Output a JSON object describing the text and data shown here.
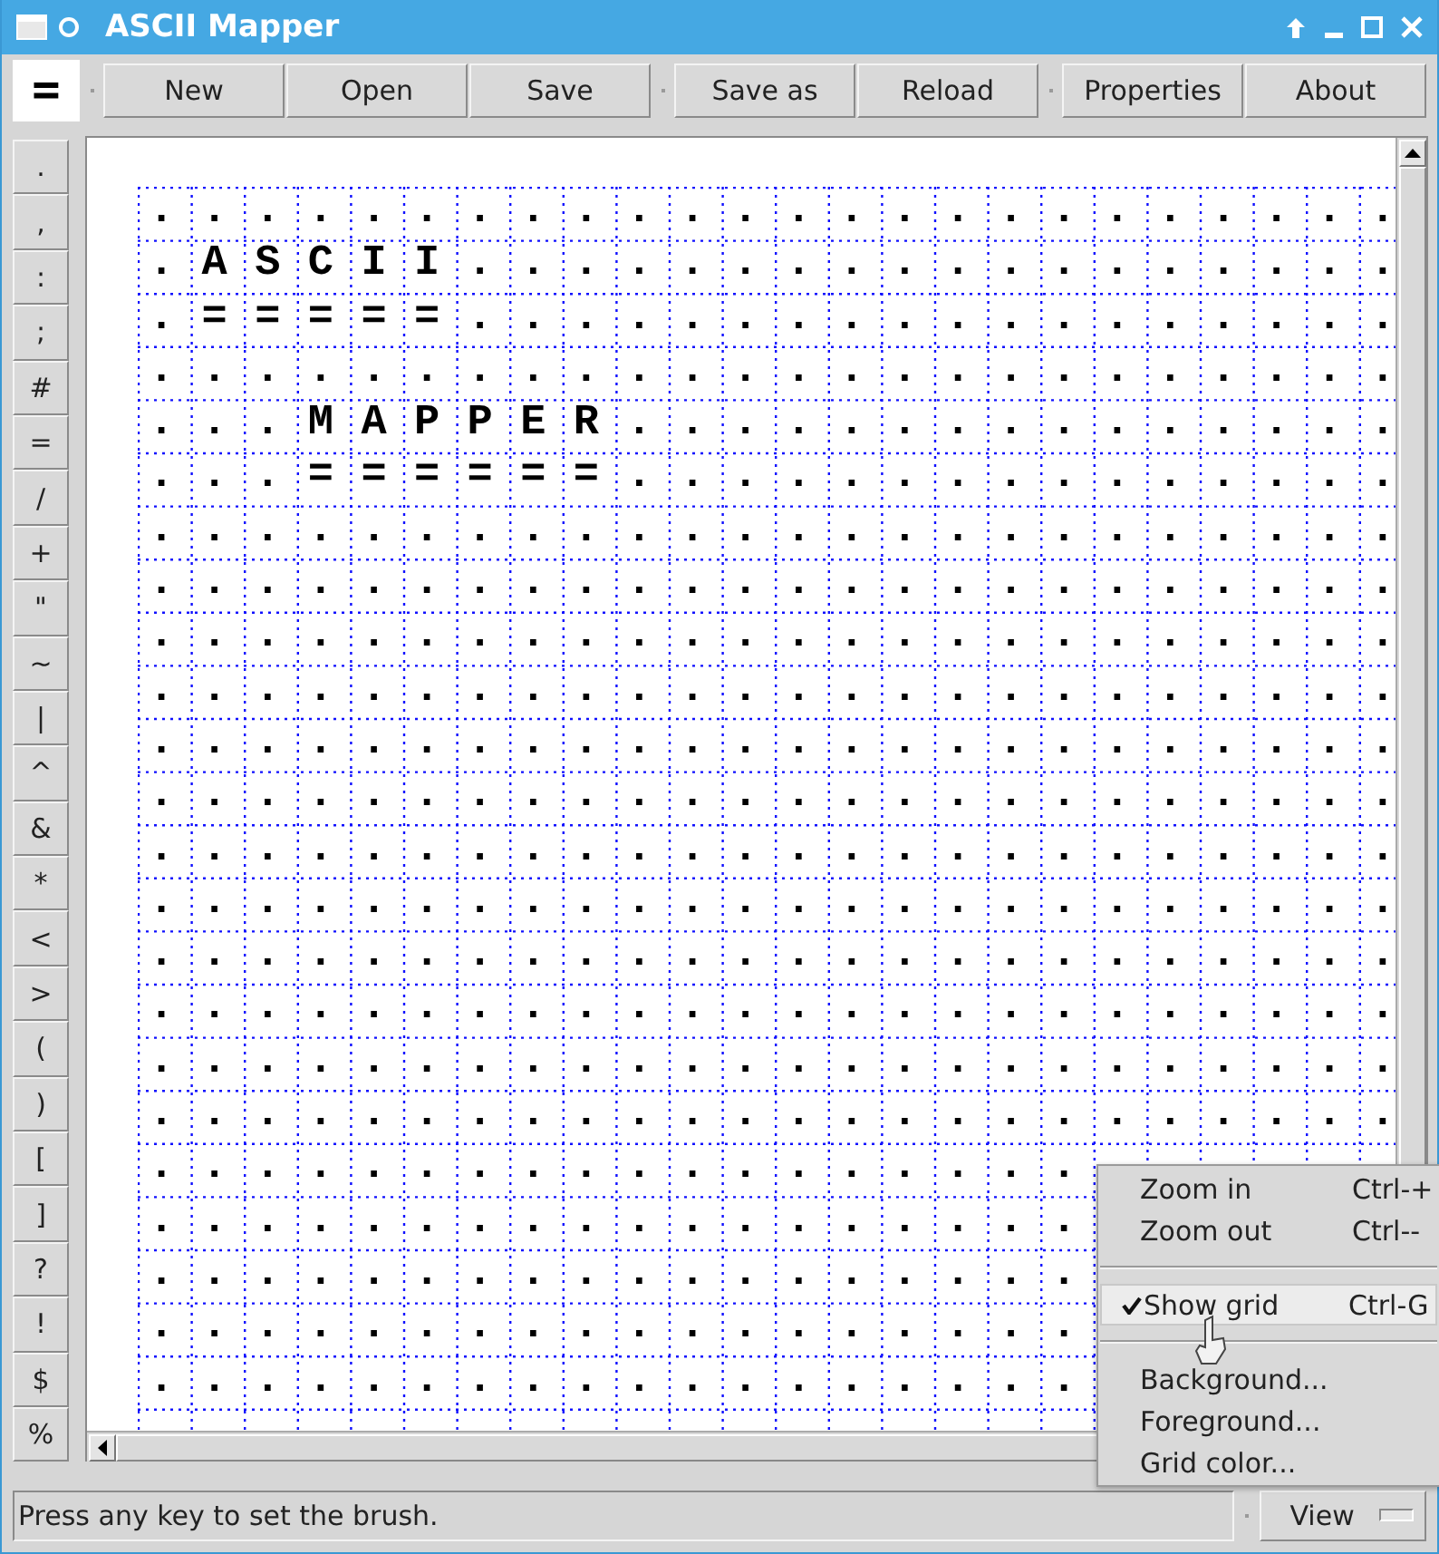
{
  "window": {
    "title": "ASCII Mapper"
  },
  "toolbar": {
    "brush": "=",
    "groups": [
      {
        "buttons": [
          {
            "label": "New"
          },
          {
            "label": "Open"
          },
          {
            "label": "Save"
          }
        ]
      },
      {
        "buttons": [
          {
            "label": "Save as"
          },
          {
            "label": "Reload"
          }
        ]
      },
      {
        "buttons": [
          {
            "label": "Properties"
          },
          {
            "label": "About"
          }
        ]
      }
    ]
  },
  "palette": [
    ".",
    ",",
    ":",
    ";",
    "#",
    "=",
    "/",
    "+",
    "\"",
    "~",
    "|",
    "^",
    "&",
    "*",
    "<",
    ">",
    "(",
    ")",
    "[",
    "]",
    "?",
    "!",
    "$",
    "%"
  ],
  "map": {
    "show_grid": true,
    "rows": [
      [
        ".",
        ".",
        ".",
        ".",
        ".",
        ".",
        ".",
        ".",
        ".",
        ".",
        ".",
        ".",
        ".",
        ".",
        ".",
        ".",
        ".",
        ".",
        ".",
        ".",
        ".",
        ".",
        ".",
        "."
      ],
      [
        ".",
        "A",
        "S",
        "C",
        "I",
        "I",
        ".",
        ".",
        ".",
        ".",
        ".",
        ".",
        ".",
        ".",
        ".",
        ".",
        ".",
        ".",
        ".",
        ".",
        ".",
        ".",
        ".",
        "."
      ],
      [
        ".",
        "=",
        "=",
        "=",
        "=",
        "=",
        ".",
        ".",
        ".",
        ".",
        ".",
        ".",
        ".",
        ".",
        ".",
        ".",
        ".",
        ".",
        ".",
        ".",
        ".",
        ".",
        ".",
        "."
      ],
      [
        ".",
        ".",
        ".",
        ".",
        ".",
        ".",
        ".",
        ".",
        ".",
        ".",
        ".",
        ".",
        ".",
        ".",
        ".",
        ".",
        ".",
        ".",
        ".",
        ".",
        ".",
        ".",
        ".",
        "."
      ],
      [
        ".",
        ".",
        ".",
        "M",
        "A",
        "P",
        "P",
        "E",
        "R",
        ".",
        ".",
        ".",
        ".",
        ".",
        ".",
        ".",
        ".",
        ".",
        ".",
        ".",
        ".",
        ".",
        ".",
        "."
      ],
      [
        ".",
        ".",
        ".",
        "=",
        "=",
        "=",
        "=",
        "=",
        "=",
        ".",
        ".",
        ".",
        ".",
        ".",
        ".",
        ".",
        ".",
        ".",
        ".",
        ".",
        ".",
        ".",
        ".",
        "."
      ],
      [
        ".",
        ".",
        ".",
        ".",
        ".",
        ".",
        ".",
        ".",
        ".",
        ".",
        ".",
        ".",
        ".",
        ".",
        ".",
        ".",
        ".",
        ".",
        ".",
        ".",
        ".",
        ".",
        ".",
        "."
      ],
      [
        ".",
        ".",
        ".",
        ".",
        ".",
        ".",
        ".",
        ".",
        ".",
        ".",
        ".",
        ".",
        ".",
        ".",
        ".",
        ".",
        ".",
        ".",
        ".",
        ".",
        ".",
        ".",
        ".",
        "."
      ],
      [
        ".",
        ".",
        ".",
        ".",
        ".",
        ".",
        ".",
        ".",
        ".",
        ".",
        ".",
        ".",
        ".",
        ".",
        ".",
        ".",
        ".",
        ".",
        ".",
        ".",
        ".",
        ".",
        ".",
        "."
      ],
      [
        ".",
        ".",
        ".",
        ".",
        ".",
        ".",
        ".",
        ".",
        ".",
        ".",
        ".",
        ".",
        ".",
        ".",
        ".",
        ".",
        ".",
        ".",
        ".",
        ".",
        ".",
        ".",
        ".",
        "."
      ],
      [
        ".",
        ".",
        ".",
        ".",
        ".",
        ".",
        ".",
        ".",
        ".",
        ".",
        ".",
        ".",
        ".",
        ".",
        ".",
        ".",
        ".",
        ".",
        ".",
        ".",
        ".",
        ".",
        ".",
        "."
      ],
      [
        ".",
        ".",
        ".",
        ".",
        ".",
        ".",
        ".",
        ".",
        ".",
        ".",
        ".",
        ".",
        ".",
        ".",
        ".",
        ".",
        ".",
        ".",
        ".",
        ".",
        ".",
        ".",
        ".",
        "."
      ],
      [
        ".",
        ".",
        ".",
        ".",
        ".",
        ".",
        ".",
        ".",
        ".",
        ".",
        ".",
        ".",
        ".",
        ".",
        ".",
        ".",
        ".",
        ".",
        ".",
        ".",
        ".",
        ".",
        ".",
        "."
      ],
      [
        ".",
        ".",
        ".",
        ".",
        ".",
        ".",
        ".",
        ".",
        ".",
        ".",
        ".",
        ".",
        ".",
        ".",
        ".",
        ".",
        ".",
        ".",
        ".",
        ".",
        ".",
        ".",
        ".",
        "."
      ],
      [
        ".",
        ".",
        ".",
        ".",
        ".",
        ".",
        ".",
        ".",
        ".",
        ".",
        ".",
        ".",
        ".",
        ".",
        ".",
        ".",
        ".",
        ".",
        ".",
        ".",
        ".",
        ".",
        ".",
        "."
      ],
      [
        ".",
        ".",
        ".",
        ".",
        ".",
        ".",
        ".",
        ".",
        ".",
        ".",
        ".",
        ".",
        ".",
        ".",
        ".",
        ".",
        ".",
        ".",
        ".",
        ".",
        ".",
        ".",
        ".",
        "."
      ],
      [
        ".",
        ".",
        ".",
        ".",
        ".",
        ".",
        ".",
        ".",
        ".",
        ".",
        ".",
        ".",
        ".",
        ".",
        ".",
        ".",
        ".",
        ".",
        ".",
        ".",
        ".",
        ".",
        ".",
        "."
      ],
      [
        ".",
        ".",
        ".",
        ".",
        ".",
        ".",
        ".",
        ".",
        ".",
        ".",
        ".",
        ".",
        ".",
        ".",
        ".",
        ".",
        ".",
        ".",
        ".",
        ".",
        ".",
        ".",
        ".",
        "."
      ],
      [
        ".",
        ".",
        ".",
        ".",
        ".",
        ".",
        ".",
        ".",
        ".",
        ".",
        ".",
        ".",
        ".",
        ".",
        ".",
        ".",
        ".",
        "."
      ],
      [
        ".",
        ".",
        ".",
        ".",
        ".",
        ".",
        ".",
        ".",
        ".",
        ".",
        ".",
        ".",
        ".",
        ".",
        ".",
        ".",
        ".",
        "."
      ],
      [
        ".",
        ".",
        ".",
        ".",
        ".",
        ".",
        ".",
        ".",
        ".",
        ".",
        ".",
        ".",
        ".",
        ".",
        ".",
        ".",
        ".",
        "."
      ],
      [
        ".",
        ".",
        ".",
        ".",
        ".",
        ".",
        ".",
        ".",
        ".",
        ".",
        ".",
        ".",
        ".",
        ".",
        ".",
        ".",
        ".",
        "."
      ],
      [
        ".",
        ".",
        ".",
        ".",
        ".",
        ".",
        ".",
        ".",
        ".",
        ".",
        ".",
        ".",
        ".",
        ".",
        ".",
        ".",
        ".",
        "."
      ]
    ]
  },
  "menu": {
    "items": [
      {
        "kind": "item",
        "label": "Zoom in",
        "shortcut": "Ctrl-+",
        "checked": false,
        "selected": false
      },
      {
        "kind": "item",
        "label": "Zoom out",
        "shortcut": "Ctrl--",
        "checked": false,
        "selected": false
      },
      {
        "kind": "separator"
      },
      {
        "kind": "item",
        "label": "Show grid",
        "shortcut": "Ctrl-G",
        "checked": true,
        "selected": true
      },
      {
        "kind": "separator"
      },
      {
        "kind": "item",
        "label": "Background...",
        "checked": false,
        "selected": false
      },
      {
        "kind": "item",
        "label": "Foreground...",
        "checked": false,
        "selected": false
      },
      {
        "kind": "item",
        "label": "Grid color...",
        "checked": false,
        "selected": false
      }
    ]
  },
  "status_bar": {
    "message": "Press any key to set the brush.",
    "view_button": {
      "label": "View"
    }
  }
}
